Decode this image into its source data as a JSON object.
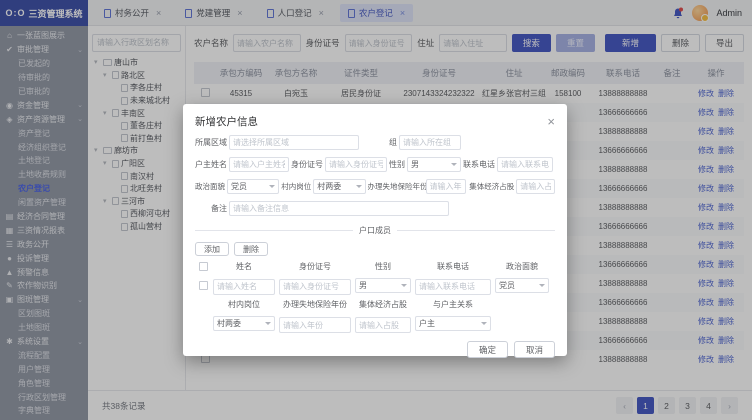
{
  "colors": {
    "primary": "#4a5cc5",
    "topbar_logo": "#4254ab",
    "sidebar_bg": "#959ba8",
    "active_link": "#4d66e8"
  },
  "glyphs": {
    "close": "×",
    "chevron": "⌄",
    "tree_caret": "▾",
    "prev": "‹",
    "next": "›"
  },
  "topbar": {
    "logo_mark": "O:O",
    "logo_text": "三资管理系统",
    "tabs": [
      {
        "label": "村务公开",
        "active": false
      },
      {
        "label": "党建管理",
        "active": false
      },
      {
        "label": "人口登记",
        "active": false
      },
      {
        "label": "农户登记",
        "active": true
      }
    ],
    "user_name": "Admin"
  },
  "sidebar": {
    "items": [
      {
        "label": "一张蓝图展示",
        "level": 0,
        "icon": "home"
      },
      {
        "label": "审批管理",
        "level": 0,
        "icon": "approval",
        "chevron": true
      },
      {
        "label": "已发起的",
        "level": 1
      },
      {
        "label": "待审批的",
        "level": 1
      },
      {
        "label": "已审批的",
        "level": 1
      },
      {
        "label": "资金管理",
        "level": 0,
        "icon": "funds",
        "chevron": true
      },
      {
        "label": "资产资源管理",
        "level": 0,
        "icon": "assets",
        "chevron": true
      },
      {
        "label": "资产登记",
        "level": 1
      },
      {
        "label": "经济组织登记",
        "level": 1
      },
      {
        "label": "土地登记",
        "level": 1
      },
      {
        "label": "土地收费规则",
        "level": 1
      },
      {
        "label": "农户登记",
        "level": 1,
        "active": true
      },
      {
        "label": "闲置资产管理",
        "level": 1
      },
      {
        "label": "经济合同管理",
        "level": 0,
        "icon": "contract"
      },
      {
        "label": "三资情况报表",
        "level": 0,
        "icon": "report"
      },
      {
        "label": "政务公开",
        "level": 0,
        "icon": "disclosure"
      },
      {
        "label": "投诉管理",
        "level": 0,
        "icon": "complaint"
      },
      {
        "label": "预警信息",
        "level": 0,
        "icon": "warning"
      },
      {
        "label": "农作物识别",
        "level": 0,
        "icon": "crop"
      },
      {
        "label": "图斑管理",
        "level": 0,
        "icon": "map",
        "chevron": true
      },
      {
        "label": "区划图斑",
        "level": 1
      },
      {
        "label": "土地图斑",
        "level": 1
      },
      {
        "label": "系统设置",
        "level": 0,
        "icon": "settings",
        "chevron": true
      },
      {
        "label": "流程配置",
        "level": 1
      },
      {
        "label": "用户管理",
        "level": 1
      },
      {
        "label": "角色管理",
        "level": 1
      },
      {
        "label": "行政区划管理",
        "level": 1
      },
      {
        "label": "字典管理",
        "level": 1
      }
    ]
  },
  "tree": {
    "search_placeholder": "请输入行政区划名称",
    "nodes": [
      {
        "label": "唐山市",
        "level": 0,
        "type": "folder",
        "expanded": true
      },
      {
        "label": "路北区",
        "level": 1,
        "type": "doc",
        "expanded": true
      },
      {
        "label": "李各庄村",
        "level": 2,
        "type": "doc"
      },
      {
        "label": "未来城北村",
        "level": 2,
        "type": "doc"
      },
      {
        "label": "丰南区",
        "level": 1,
        "type": "doc",
        "expanded": true
      },
      {
        "label": "董各庄村",
        "level": 2,
        "type": "doc"
      },
      {
        "label": "前打鱼村",
        "level": 2,
        "type": "doc"
      },
      {
        "label": "廊坊市",
        "level": 0,
        "type": "folder",
        "expanded": true
      },
      {
        "label": "广阳区",
        "level": 1,
        "type": "doc",
        "expanded": true
      },
      {
        "label": "南汉村",
        "level": 2,
        "type": "doc"
      },
      {
        "label": "北旺务村",
        "level": 2,
        "type": "doc"
      },
      {
        "label": "三河市",
        "level": 1,
        "type": "doc",
        "expanded": true
      },
      {
        "label": "西柳河屯村",
        "level": 2,
        "type": "doc"
      },
      {
        "label": "孤山营村",
        "level": 2,
        "type": "doc"
      }
    ]
  },
  "toolbar": {
    "filters": [
      {
        "label": "农户名称",
        "placeholder": "请输入农户名称"
      },
      {
        "label": "身份证号",
        "placeholder": "请输入身份证号"
      },
      {
        "label": "住址",
        "placeholder": "请输入住址"
      }
    ],
    "search_label": "搜索",
    "reset_label": "重置",
    "add_label": "新增",
    "delete_label": "删除",
    "export_label": "导出"
  },
  "table": {
    "columns": [
      "承包方编码",
      "承包方名称",
      "证件类型",
      "身份证号",
      "住址",
      "邮政编码",
      "联系电话",
      "备注",
      "操作"
    ],
    "action_edit": "修改",
    "action_delete": "删除",
    "rows": [
      {
        "code": "45315",
        "name": "白宛玉",
        "id_type": "居民身份证",
        "id_no": "2307143324232322",
        "address": "红星乡张官村三组",
        "zip": "158100",
        "phone": "13888888888",
        "note": ""
      },
      {
        "code": "",
        "name": "",
        "id_type": "",
        "id_no": "",
        "address": "",
        "zip": "",
        "phone": "13666666666",
        "note": ""
      },
      {
        "code": "",
        "name": "",
        "id_type": "",
        "id_no": "",
        "address": "",
        "zip": "",
        "phone": "13888888888",
        "note": ""
      },
      {
        "code": "",
        "name": "",
        "id_type": "",
        "id_no": "",
        "address": "",
        "zip": "",
        "phone": "13666666666",
        "note": ""
      },
      {
        "code": "",
        "name": "",
        "id_type": "",
        "id_no": "",
        "address": "",
        "zip": "",
        "phone": "13888888888",
        "note": ""
      },
      {
        "code": "",
        "name": "",
        "id_type": "",
        "id_no": "",
        "address": "",
        "zip": "",
        "phone": "13666666666",
        "note": ""
      },
      {
        "code": "",
        "name": "",
        "id_type": "",
        "id_no": "",
        "address": "",
        "zip": "",
        "phone": "13888888888",
        "note": ""
      },
      {
        "code": "",
        "name": "",
        "id_type": "",
        "id_no": "",
        "address": "",
        "zip": "",
        "phone": "13666666666",
        "note": ""
      },
      {
        "code": "",
        "name": "",
        "id_type": "",
        "id_no": "",
        "address": "",
        "zip": "",
        "phone": "13888888888",
        "note": ""
      },
      {
        "code": "",
        "name": "",
        "id_type": "",
        "id_no": "",
        "address": "",
        "zip": "",
        "phone": "13666666666",
        "note": ""
      },
      {
        "code": "",
        "name": "",
        "id_type": "",
        "id_no": "",
        "address": "",
        "zip": "",
        "phone": "13888888888",
        "note": ""
      },
      {
        "code": "",
        "name": "",
        "id_type": "",
        "id_no": "",
        "address": "",
        "zip": "",
        "phone": "13666666666",
        "note": ""
      },
      {
        "code": "",
        "name": "",
        "id_type": "",
        "id_no": "",
        "address": "",
        "zip": "",
        "phone": "13888888888",
        "note": ""
      },
      {
        "code": "",
        "name": "",
        "id_type": "",
        "id_no": "",
        "address": "",
        "zip": "",
        "phone": "13666666666",
        "note": ""
      },
      {
        "code": "",
        "name": "",
        "id_type": "",
        "id_no": "",
        "address": "",
        "zip": "",
        "phone": "13888888888",
        "note": ""
      }
    ]
  },
  "pagination": {
    "total_text": "共38条记录",
    "pages": [
      "1",
      "2",
      "3",
      "4"
    ],
    "active_page": "1"
  },
  "modal": {
    "title": "新增农户信息",
    "fields": {
      "region_label": "所属区域",
      "region_placeholder": "请选择所属区域",
      "group_label": "组",
      "group_placeholder": "请输入所在组",
      "head_name_label": "户主姓名",
      "head_name_placeholder": "请输入户主姓名",
      "id_label": "身份证号",
      "id_placeholder": "请输入身份证号",
      "gender_label": "性别",
      "gender_value": "男",
      "phone_label": "联系电话",
      "phone_placeholder": "请输入联系电话",
      "political_label": "政治面貌",
      "political_value": "党员",
      "village_post_label": "村内岗位",
      "village_post_value": "村两委",
      "insurance_label": "办理失地保险年份",
      "insurance_placeholder": "请输入年份",
      "share_label": "集体经济占股",
      "share_placeholder": "请输入占股",
      "remark_label": "备注",
      "remark_placeholder": "请输入备注信息"
    },
    "members": {
      "section_title": "户口成员",
      "add_label": "添加",
      "delete_label": "删除",
      "col_name": "姓名",
      "col_id": "身份证号",
      "col_gender": "性别",
      "col_phone": "联系电话",
      "col_political": "政治面貌",
      "ph_name": "请输入姓名",
      "ph_id": "请输入身份证号",
      "gender_value": "男",
      "ph_phone": "请输入联系电话",
      "political_value": "党员",
      "col_post": "村内岗位",
      "col_insurance": "办理失地保险年份",
      "col_share": "集体经济占股",
      "col_relation": "与户主关系",
      "post_value": "村两委",
      "ph_insurance": "请输入年份",
      "ph_share": "请输入占股",
      "relation_value": "户主"
    },
    "footer": {
      "confirm": "确定",
      "cancel": "取消"
    }
  }
}
